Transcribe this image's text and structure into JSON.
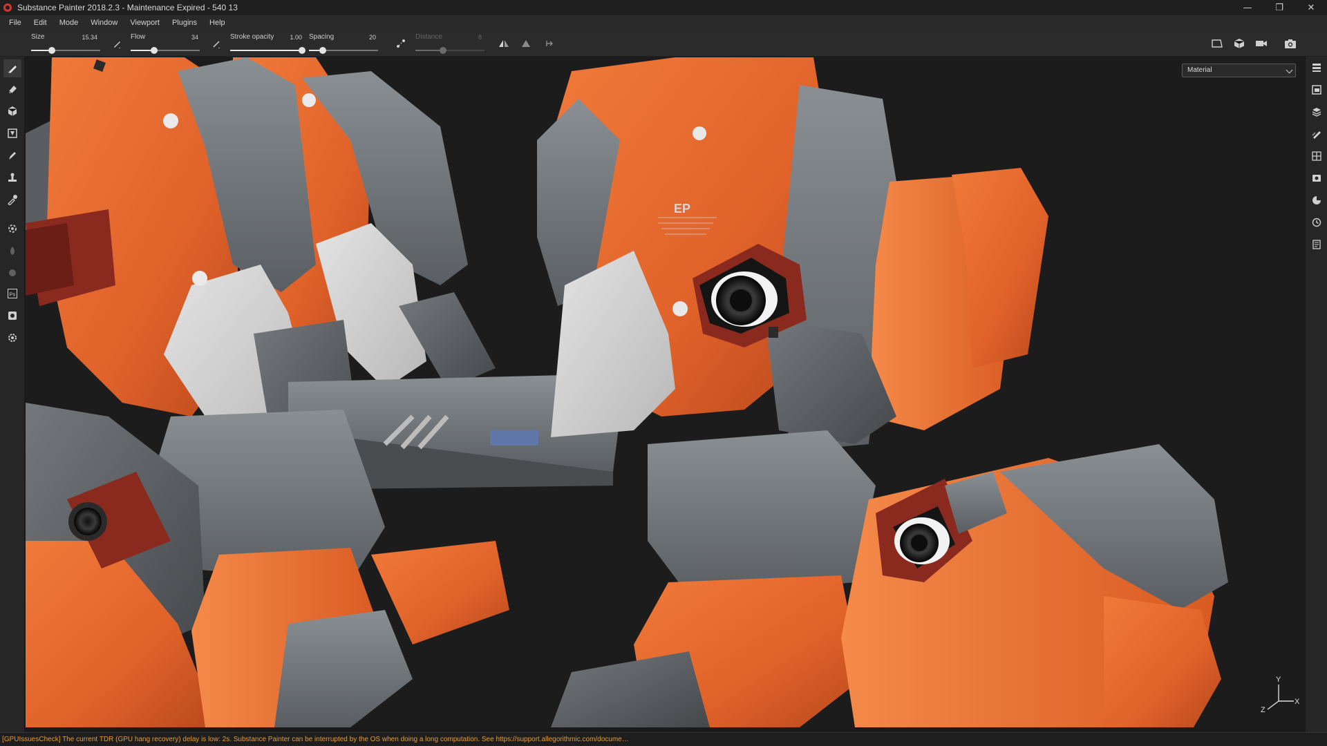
{
  "window": {
    "title": "Substance Painter 2018.2.3 - Maintenance Expired - 540 13",
    "controls": {
      "minimize": "—",
      "restore": "❐",
      "close": "✕"
    }
  },
  "menu": {
    "items": [
      "File",
      "Edit",
      "Mode",
      "Window",
      "Viewport",
      "Plugins",
      "Help"
    ]
  },
  "toolbar": {
    "size": {
      "label": "Size",
      "value": "15.34",
      "level": 0.3
    },
    "flow": {
      "label": "Flow",
      "value": "34",
      "level": 0.34
    },
    "stroke_opacity": {
      "label": "Stroke opacity",
      "value": "1.00",
      "level": 1.0
    },
    "spacing": {
      "label": "Spacing",
      "value": "20",
      "level": 0.2
    },
    "distance": {
      "label": "Distance",
      "value": "8",
      "level": 0.4
    }
  },
  "viewport": {
    "channel_select": {
      "value": "Material"
    },
    "axis": {
      "y": "Y",
      "x": "X",
      "z": "Z"
    }
  },
  "status": {
    "message": "[GPUIssuesCheck] The current TDR (GPU hang recovery) delay is low: 2s. Substance Painter can be interrupted by the OS when doing a long computation. See https://support.allegorithmic.com/docume…"
  },
  "colors": {
    "accent": "#e36a2b",
    "status_text": "#e39b3a",
    "metal": "#6f7478",
    "background": "#1c1c1c"
  },
  "icons": {
    "left_tools": [
      "brush-icon",
      "eraser-icon",
      "projection-icon",
      "polygon-fill-icon",
      "smudge-icon",
      "clone-icon",
      "color-picker-icon",
      "bake-icon",
      "gpu-icon",
      "material-icon",
      "photoshop-icon",
      "export-icon",
      "settings-icon"
    ],
    "right_dock": [
      "layers-panel-icon",
      "texture-set-icon",
      "stack-icon",
      "properties-icon",
      "uv-icon",
      "display-settings-icon",
      "shelf-icon",
      "history-icon",
      "log-icon"
    ]
  }
}
